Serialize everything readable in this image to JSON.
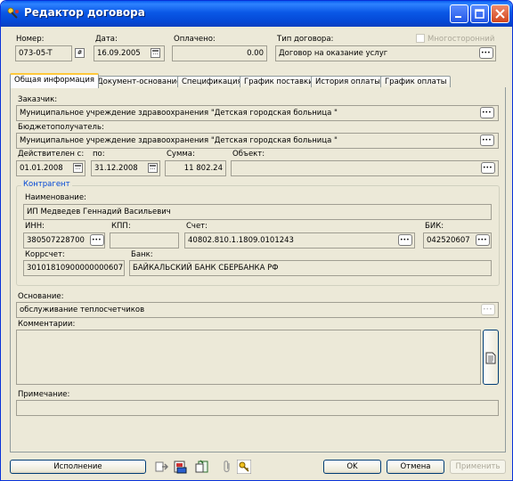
{
  "window": {
    "title": "Редактор договора"
  },
  "header": {
    "number_label": "Номер:",
    "number_value": "073-05-T",
    "date_label": "Дата:",
    "date_value": "16.09.2005",
    "paid_label": "Оплачено:",
    "paid_value": "0.00",
    "type_label": "Тип договора:",
    "type_value": "Договор на оказание услуг",
    "multilateral_label": "Многосторонний"
  },
  "tabs": [
    {
      "label": "Общая информация"
    },
    {
      "label": "Документ-основание"
    },
    {
      "label": "Спецификация"
    },
    {
      "label": "График поставки"
    },
    {
      "label": "История оплаты"
    },
    {
      "label": "График оплаты"
    }
  ],
  "general": {
    "customer_label": "Заказчик:",
    "customer_value": "Муниципальное учреждение здравоохранения \"Детская городская больница \"",
    "budget_label": "Бюджетополучатель:",
    "budget_value": "Муниципальное учреждение здравоохранения \"Детская городская больница \"",
    "valid_from_label": "Действителен с:",
    "valid_from_value": "01.01.2008",
    "valid_to_label": "по:",
    "valid_to_value": "31.12.2008",
    "sum_label": "Сумма:",
    "sum_value": "11 802.24",
    "object_label": "Объект:",
    "object_value": ""
  },
  "contractor": {
    "legend": "Контрагент",
    "name_label": "Наименование:",
    "name_value": "ИП Медведев Геннадий Васильевич",
    "inn_label": "ИНН:",
    "inn_value": "380507228700",
    "kpp_label": "КПП:",
    "kpp_value": "",
    "account_label": "Счет:",
    "account_value": "40802.810.1.1809.0101243",
    "bik_label": "БИК:",
    "bik_value": "042520607",
    "corr_label": "Коррсчет:",
    "corr_value": "30101810900000000607",
    "bank_label": "Банк:",
    "bank_value": "БАЙКАЛЬСКИЙ БАНК СБЕРБАНКА РФ"
  },
  "basis": {
    "label": "Основание:",
    "value": "обслуживание теплосчетчиков"
  },
  "comments": {
    "label": "Комментарии:",
    "value": ""
  },
  "note": {
    "label": "Примечание:",
    "value": ""
  },
  "footer": {
    "execution_label": "Исполнение",
    "ok_label": "OK",
    "cancel_label": "Отмена",
    "apply_label": "Применить"
  }
}
